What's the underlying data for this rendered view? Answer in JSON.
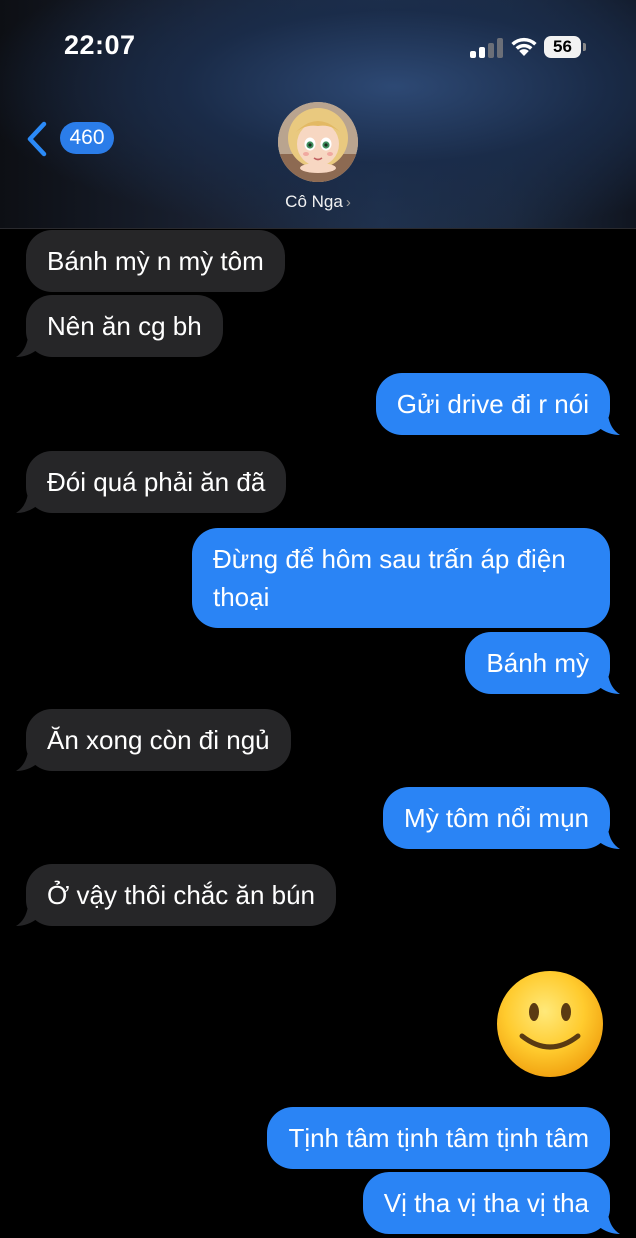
{
  "status_bar": {
    "time": "22:07",
    "battery": "56"
  },
  "nav": {
    "back_count": "460",
    "contact_name": "Cô Nga"
  },
  "messages": [
    {
      "direction": "in",
      "text": "Bánh mỳ n mỳ tôm"
    },
    {
      "direction": "in",
      "text": "Nên ăn cg bh"
    },
    {
      "direction": "out",
      "text": "Gửi drive đi r nói"
    },
    {
      "direction": "in",
      "text": "Đói quá phải ăn đã"
    },
    {
      "direction": "out",
      "text": "Đừng để hôm sau trấn áp điện thoại"
    },
    {
      "direction": "out",
      "text": "Bánh mỳ"
    },
    {
      "direction": "in",
      "text": "Ăn xong còn đi ngủ"
    },
    {
      "direction": "out",
      "text": "Mỳ tôm nổi mụn"
    },
    {
      "direction": "in",
      "text": "Ở vậy thôi chắc ăn bún"
    },
    {
      "direction": "out",
      "emoji": "slightly-smiling-face-emoji"
    },
    {
      "direction": "out",
      "text": "Tịnh tâm tịnh tâm tịnh tâm"
    },
    {
      "direction": "out",
      "text": "Vị tha vị tha vị tha"
    }
  ],
  "colors": {
    "outgoing": "#2a84f5",
    "incoming": "#262628",
    "accent": "#2b7de9"
  }
}
